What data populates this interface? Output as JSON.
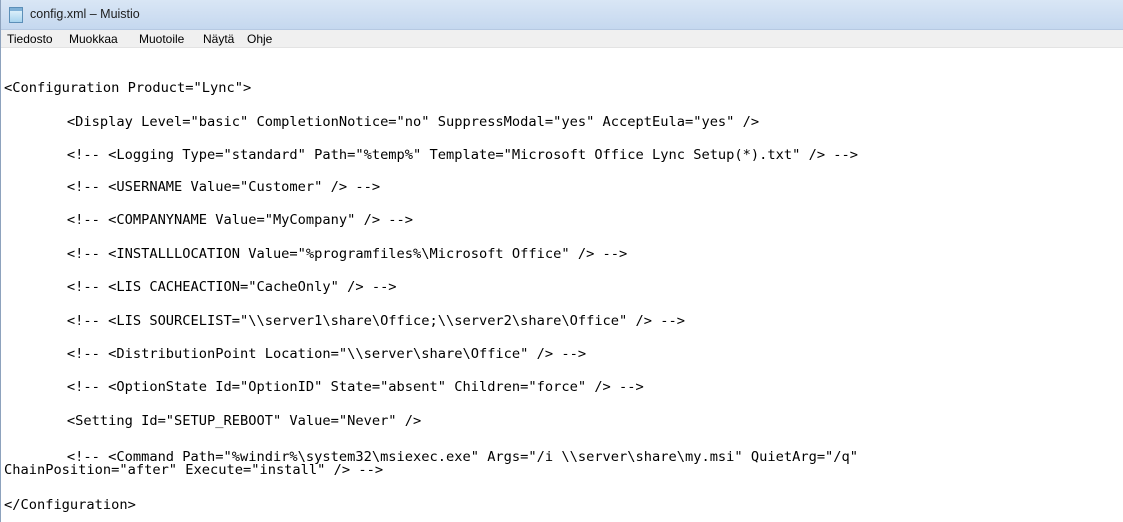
{
  "window": {
    "title": "config.xml – Muistio",
    "icon": "notepad-icon"
  },
  "menu": {
    "items": [
      "Tiedosto",
      "Muokkaa",
      "Muotoile",
      "Näytä",
      "Ohje"
    ]
  },
  "editor": {
    "lines": [
      "<Configuration Product=\"Lync\">",
      "        <Display Level=\"basic\" CompletionNotice=\"no\" SuppressModal=\"yes\" AcceptEula=\"yes\" />",
      "        <!-- <Logging Type=\"standard\" Path=\"%temp%\" Template=\"Microsoft Office Lync Setup(*).txt\" /> -->",
      "        <!-- <USERNAME Value=\"Customer\" /> -->",
      "        <!-- <COMPANYNAME Value=\"MyCompany\" /> -->",
      "        <!-- <INSTALLLOCATION Value=\"%programfiles%\\Microsoft Office\" /> -->",
      "        <!-- <LIS CACHEACTION=\"CacheOnly\" /> -->",
      "        <!-- <LIS SOURCELIST=\"\\\\server1\\share\\Office;\\\\server2\\share\\Office\" /> -->",
      "        <!-- <DistributionPoint Location=\"\\\\server\\share\\Office\" /> -->",
      "        <!-- <OptionState Id=\"OptionID\" State=\"absent\" Children=\"force\" /> -->",
      "        <Setting Id=\"SETUP_REBOOT\" Value=\"Never\" />",
      "        <!-- <Command Path=\"%windir%\\system32\\msiexec.exe\" Args=\"/i \\\\server\\share\\my.msi\" QuietArg=\"/q\"",
      "ChainPosition=\"after\" Execute=\"install\" /> -->",
      "</Configuration>"
    ]
  }
}
